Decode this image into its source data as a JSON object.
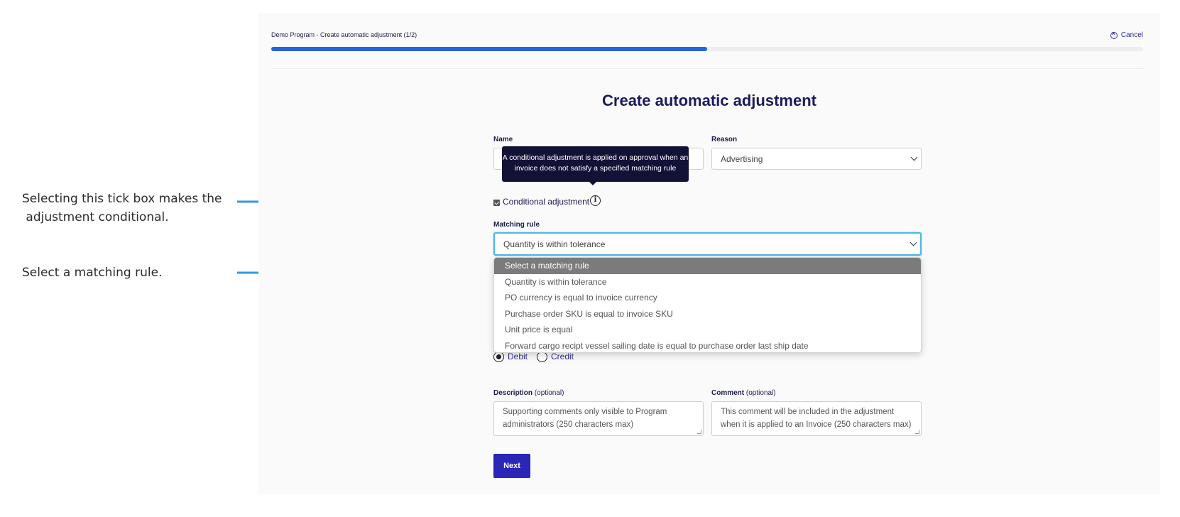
{
  "annotations": {
    "checkbox_note": "Selecting this tick box makes the\n adjustment conditional.",
    "rule_note": "Select a matching rule."
  },
  "header": {
    "breadcrumb": "Demo Program - Create automatic adjustment (1/2)",
    "cancel_label": "Cancel",
    "progress_fraction": 0.5
  },
  "form": {
    "title": "Create automatic adjustment",
    "name_label": "Name",
    "reason_label": "Reason",
    "reason_value": "Advertising",
    "tooltip_text": "A conditional adjustment is applied on approval when an invoice does not satisfy a specified matching rule",
    "conditional_label": "Conditional adjustment",
    "conditional_checked": true,
    "matching_label": "Matching rule",
    "matching_value": "Quantity is within tolerance",
    "matching_options": [
      "Select a matching rule",
      "Quantity is within tolerance",
      "PO currency is equal to invoice currency",
      "Purchase order SKU is equal to invoice SKU",
      "Unit price is equal",
      "Forward cargo recipt vessel sailing date is equal to purchase order last ship date"
    ],
    "debit_label": "Debit",
    "credit_label": "Credit",
    "description_label": "Description",
    "description_optional": "(optional)",
    "description_placeholder": "Supporting comments only visible to Program administrators (250 characters max)",
    "comment_label": "Comment",
    "comment_optional": "(optional)",
    "comment_placeholder": "This comment will be included in the adjustment when it is applied to an Invoice (250 characters max)",
    "next_label": "Next"
  },
  "colors": {
    "accent": "#2a26b8",
    "progress": "#2563e0",
    "annotation_arrow": "#3399e0",
    "tooltip_bg": "#121136"
  }
}
